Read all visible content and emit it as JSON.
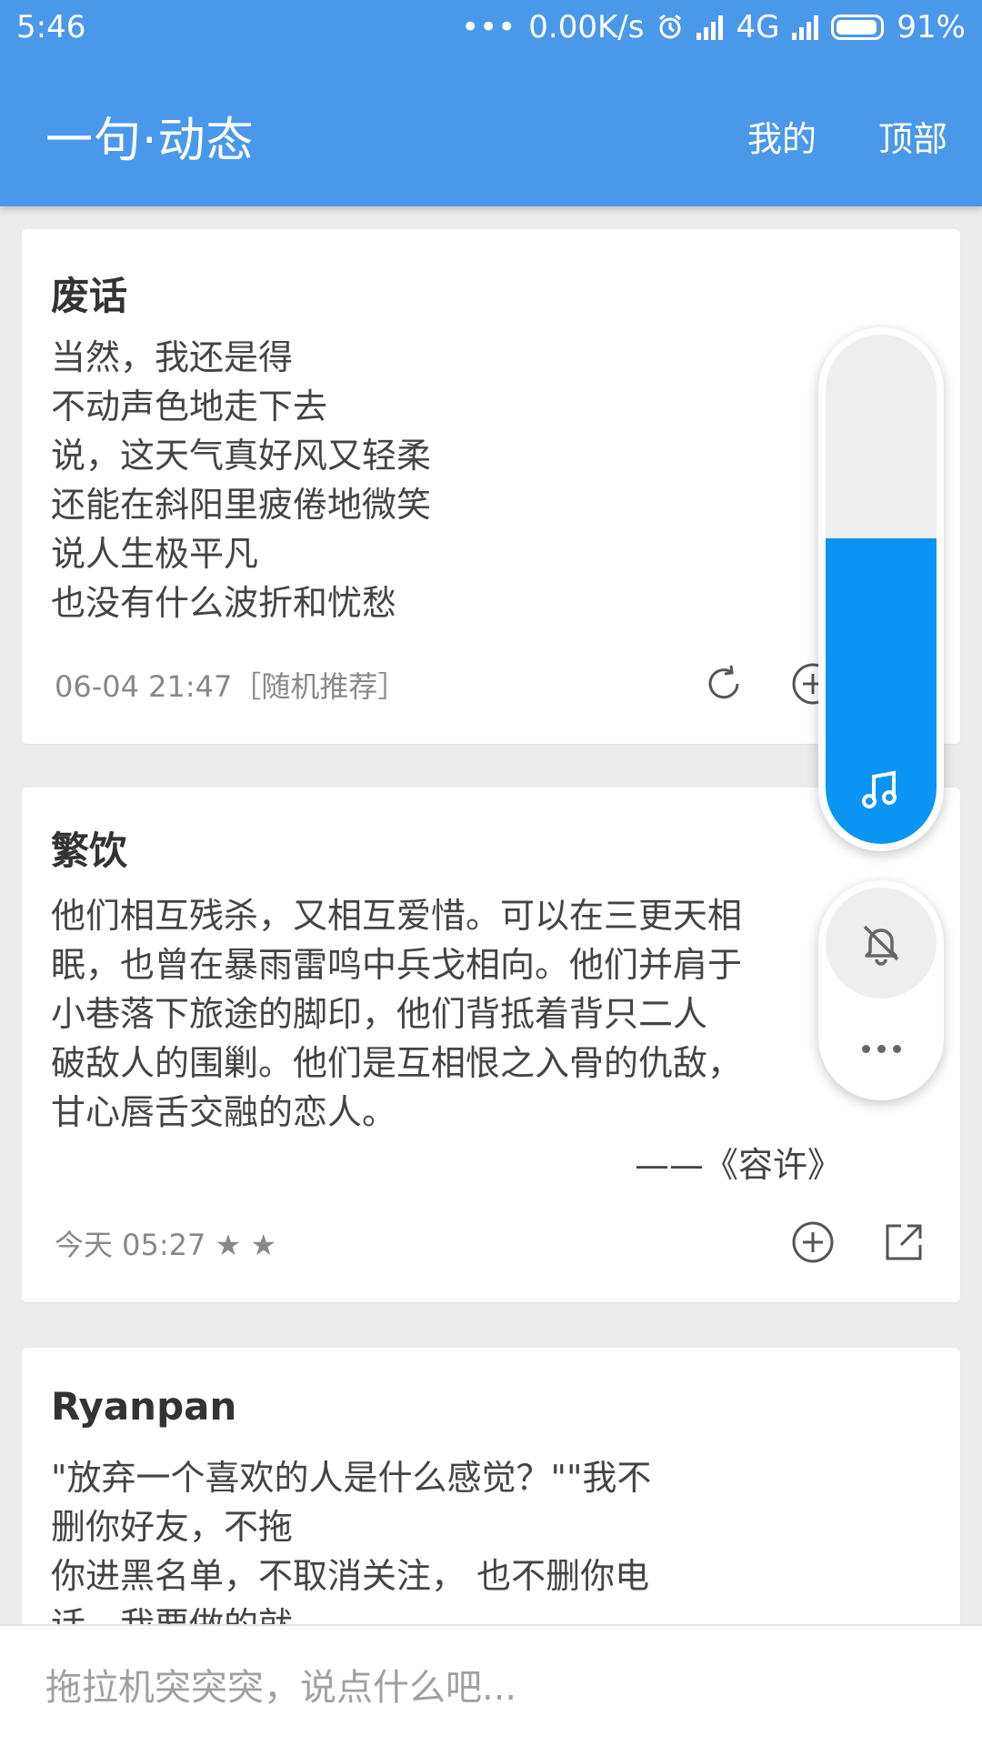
{
  "status_bar": {
    "time": "5:46",
    "dots": "•••",
    "net_speed": "0.00K/s",
    "network_type": "4G",
    "battery": "91%"
  },
  "header": {
    "title": "一句·动态",
    "nav": {
      "mine": "我的",
      "top": "顶部"
    }
  },
  "posts": [
    {
      "author": "废话",
      "text": "当然，我还是得\n不动声色地走下去\n说，这天气真好风又轻柔\n还能在斜阳里疲倦地微笑\n说人生极平凡\n也没有什么波折和忧愁",
      "source": "",
      "meta": "06-04 21:47［随机推荐］",
      "actions": [
        "refresh-icon",
        "add-icon"
      ]
    },
    {
      "author": "繁饮",
      "text": "他们相互残杀，又相互爱惜。可以在三更天相\n眠，也曾在暴雨雷鸣中兵戈相向。他们并肩于\n小巷落下旅途的脚印，他们背抵着背只二人\n破敌人的围剿。他们是互相恨之入骨的仇敌，\n甘心唇舌交融的恋人。",
      "source": "——《容许》",
      "meta": "今天 05:27 ★ ★",
      "actions": [
        "add-icon",
        "share-icon"
      ]
    },
    {
      "author": "Ryanpan",
      "text": "\"放弃一个喜欢的人是什么感觉？\"\"我不\n删你好友，不拖\n你进黑名单，不取消关注， 也不删你电\n话，我要做的就",
      "source": "",
      "meta": "",
      "actions": []
    }
  ],
  "float_widget": {
    "volume_level": 0.6,
    "icons": [
      "music-note-icon",
      "bell-off-icon",
      "more-icon"
    ]
  },
  "comment_box": {
    "placeholder": "拖拉机突突突，说点什么吧..."
  },
  "colors": {
    "primary": "#4a98ea",
    "volume_fill": "#0a94f4",
    "background": "#ececec"
  }
}
